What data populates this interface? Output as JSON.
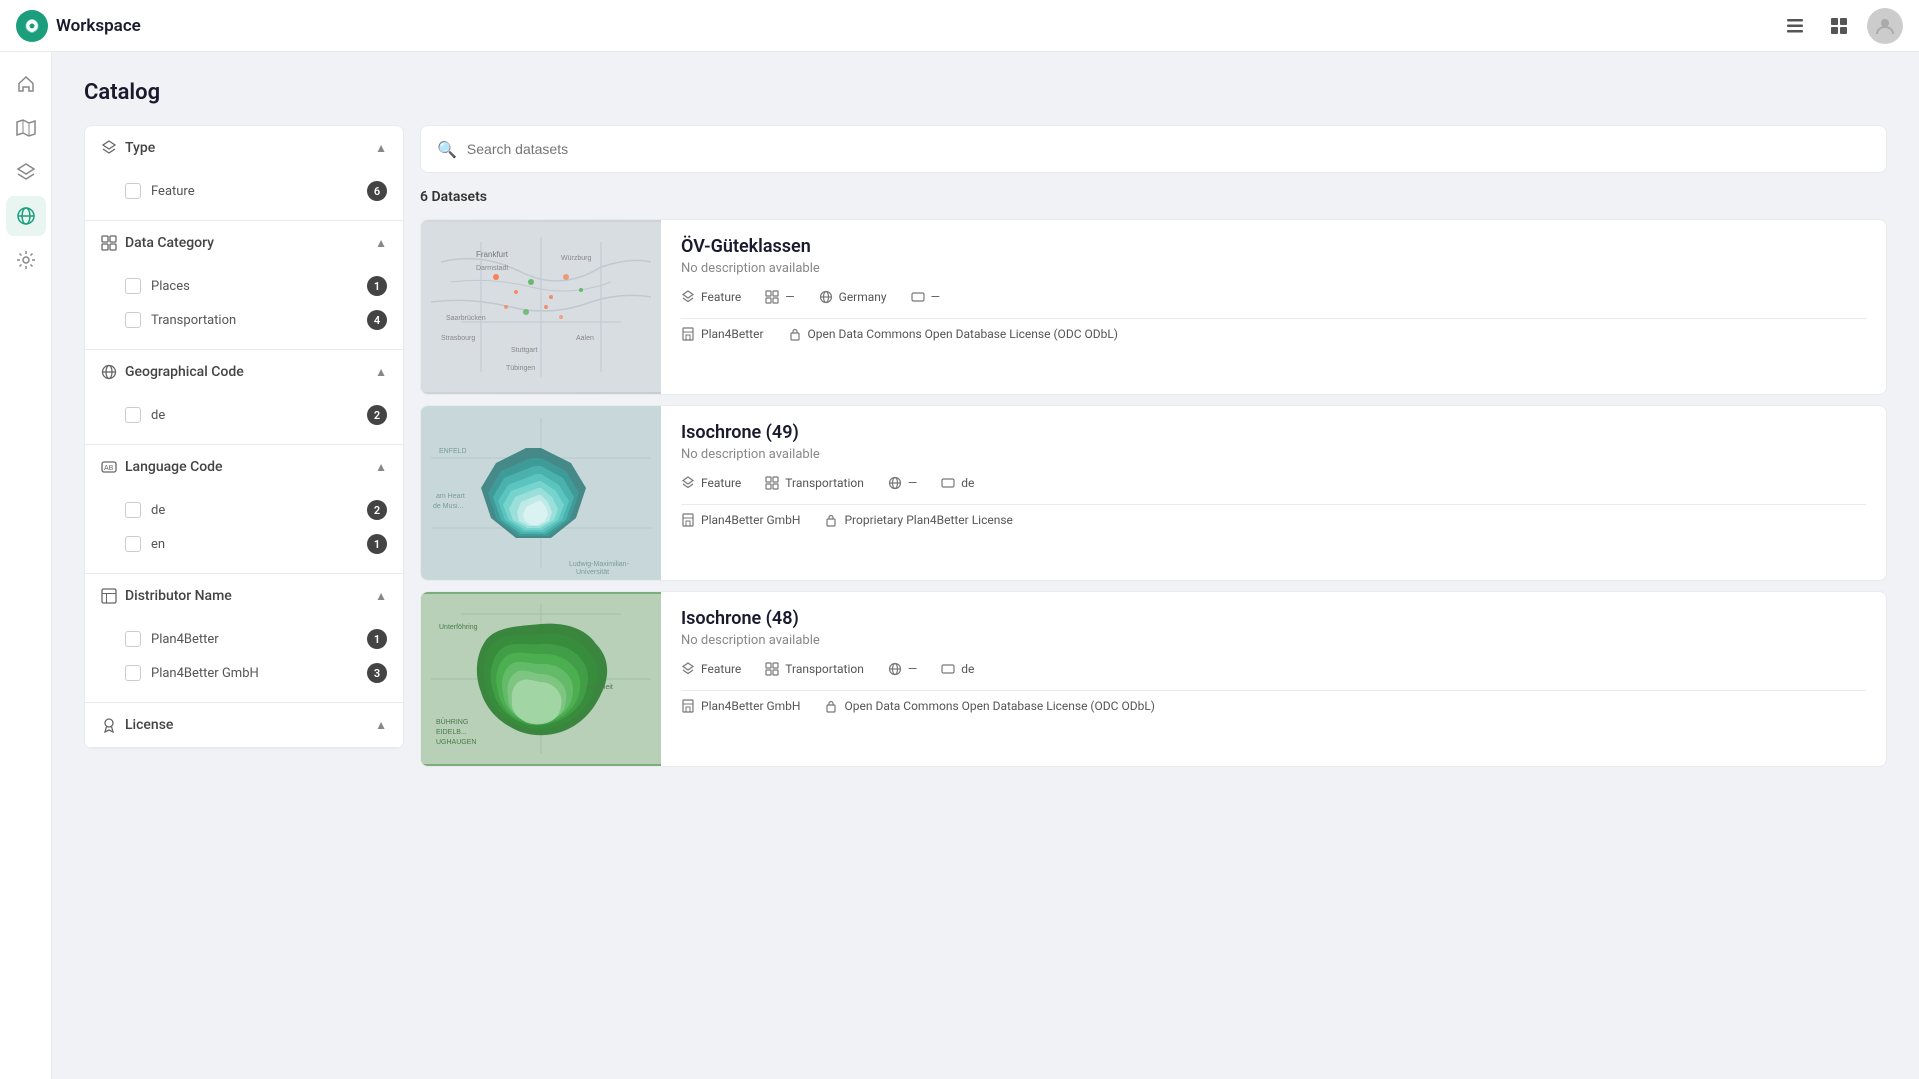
{
  "topbar": {
    "title": "Workspace",
    "icon1": "list-icon",
    "icon2": "grid-icon"
  },
  "nav": {
    "items": [
      {
        "id": "home",
        "icon": "home-icon",
        "active": false
      },
      {
        "id": "map",
        "icon": "map-icon",
        "active": false
      },
      {
        "id": "layers",
        "icon": "layers-icon",
        "active": false
      },
      {
        "id": "globe",
        "icon": "globe-icon",
        "active": true
      },
      {
        "id": "settings",
        "icon": "settings-icon",
        "active": false
      }
    ]
  },
  "page": {
    "title": "Catalog"
  },
  "search": {
    "placeholder": "Search datasets"
  },
  "datasets_count": "6 Datasets",
  "filters": {
    "sections": [
      {
        "id": "type",
        "label": "Type",
        "icon": "layers-icon",
        "expanded": true,
        "items": [
          {
            "label": "Feature",
            "count": 6
          }
        ]
      },
      {
        "id": "data-category",
        "label": "Data Category",
        "icon": "category-icon",
        "expanded": true,
        "items": [
          {
            "label": "Places",
            "count": 1
          },
          {
            "label": "Transportation",
            "count": 4
          }
        ]
      },
      {
        "id": "geographical-code",
        "label": "Geographical Code",
        "icon": "globe-icon",
        "expanded": true,
        "items": [
          {
            "label": "de",
            "count": 2
          }
        ]
      },
      {
        "id": "language-code",
        "label": "Language Code",
        "icon": "language-icon",
        "expanded": true,
        "items": [
          {
            "label": "de",
            "count": 2
          },
          {
            "label": "en",
            "count": 1
          }
        ]
      },
      {
        "id": "distributor-name",
        "label": "Distributor Name",
        "icon": "distributor-icon",
        "expanded": true,
        "items": [
          {
            "label": "Plan4Better",
            "count": 1
          },
          {
            "label": "Plan4Better GmbH",
            "count": 3
          }
        ]
      },
      {
        "id": "license",
        "label": "License",
        "icon": "license-icon",
        "expanded": true,
        "items": []
      }
    ]
  },
  "datasets": [
    {
      "id": 1,
      "name": "ÖV-Güteklassen",
      "description": "No description available",
      "thumb_type": "map1",
      "meta": {
        "type": "Feature",
        "category": "—",
        "geo": "Germany",
        "lang": "—",
        "distributor": "Plan4Better",
        "license": "Open Data Commons Open Database License (ODC ODbL)"
      }
    },
    {
      "id": 2,
      "name": "Isochrone (49)",
      "description": "No description available",
      "thumb_type": "map2",
      "meta": {
        "type": "Feature",
        "category": "Transportation",
        "geo": "—",
        "lang": "de",
        "distributor": "Plan4Better GmbH",
        "license": "Proprietary Plan4Better License"
      }
    },
    {
      "id": 3,
      "name": "Isochrone (48)",
      "description": "No description available",
      "thumb_type": "map3",
      "meta": {
        "type": "Feature",
        "category": "Transportation",
        "geo": "—",
        "lang": "de",
        "distributor": "Plan4Better GmbH",
        "license": "Open Data Commons Open Database License (ODC ODbL)"
      }
    }
  ]
}
